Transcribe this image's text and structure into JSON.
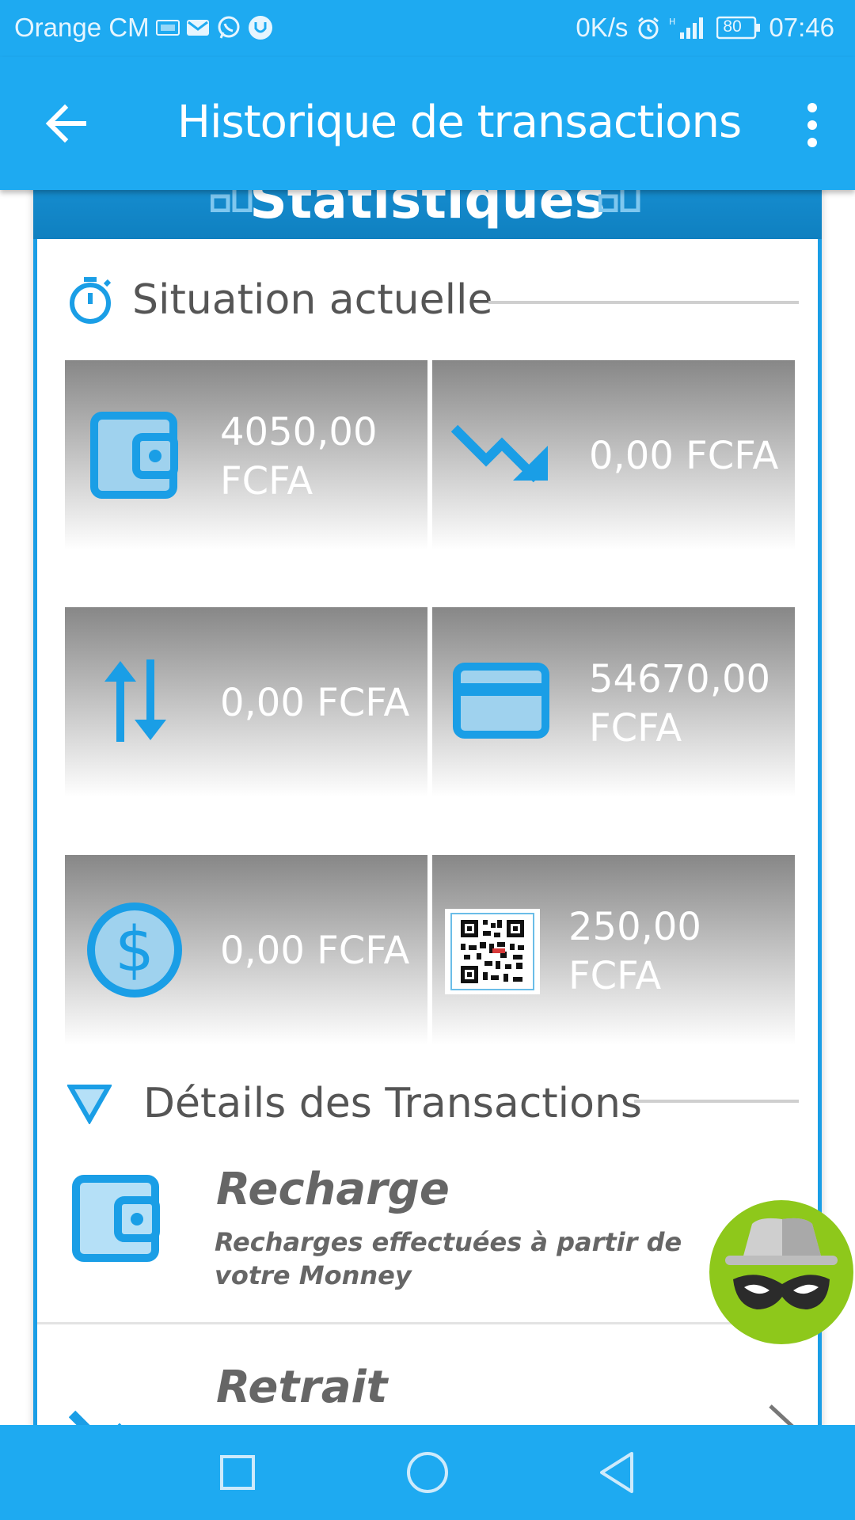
{
  "status_bar": {
    "carrier": "Orange CM",
    "net_speed": "0K/s",
    "battery": "80",
    "time": "07:46"
  },
  "app_bar": {
    "title": "Historique de transactions"
  },
  "card": {
    "header_title": "Statistiques",
    "section_current": "Situation actuelle",
    "tiles": [
      {
        "icon": "wallet-icon",
        "value": "4050,00 FCFA"
      },
      {
        "icon": "trending-down-icon",
        "value": "0,00 FCFA"
      },
      {
        "icon": "transfer-arrows-icon",
        "value": "0,00 FCFA"
      },
      {
        "icon": "credit-card-icon",
        "value": "54670,00 FCFA"
      },
      {
        "icon": "dollar-circle-icon",
        "value": "0,00 FCFA"
      },
      {
        "icon": "qr-code-icon",
        "value": "250,00 FCFA"
      }
    ],
    "section_details": "Détails des Transactions",
    "details": [
      {
        "title": "Recharge",
        "description": "Recharges effectuées à partir de votre Monney"
      },
      {
        "title": "Retrait",
        "description": ""
      }
    ]
  },
  "colors": {
    "accent": "#1eaaf1",
    "header": "#1b97dc",
    "icon": "#1a9ee6",
    "fab": "#8ec81b"
  }
}
